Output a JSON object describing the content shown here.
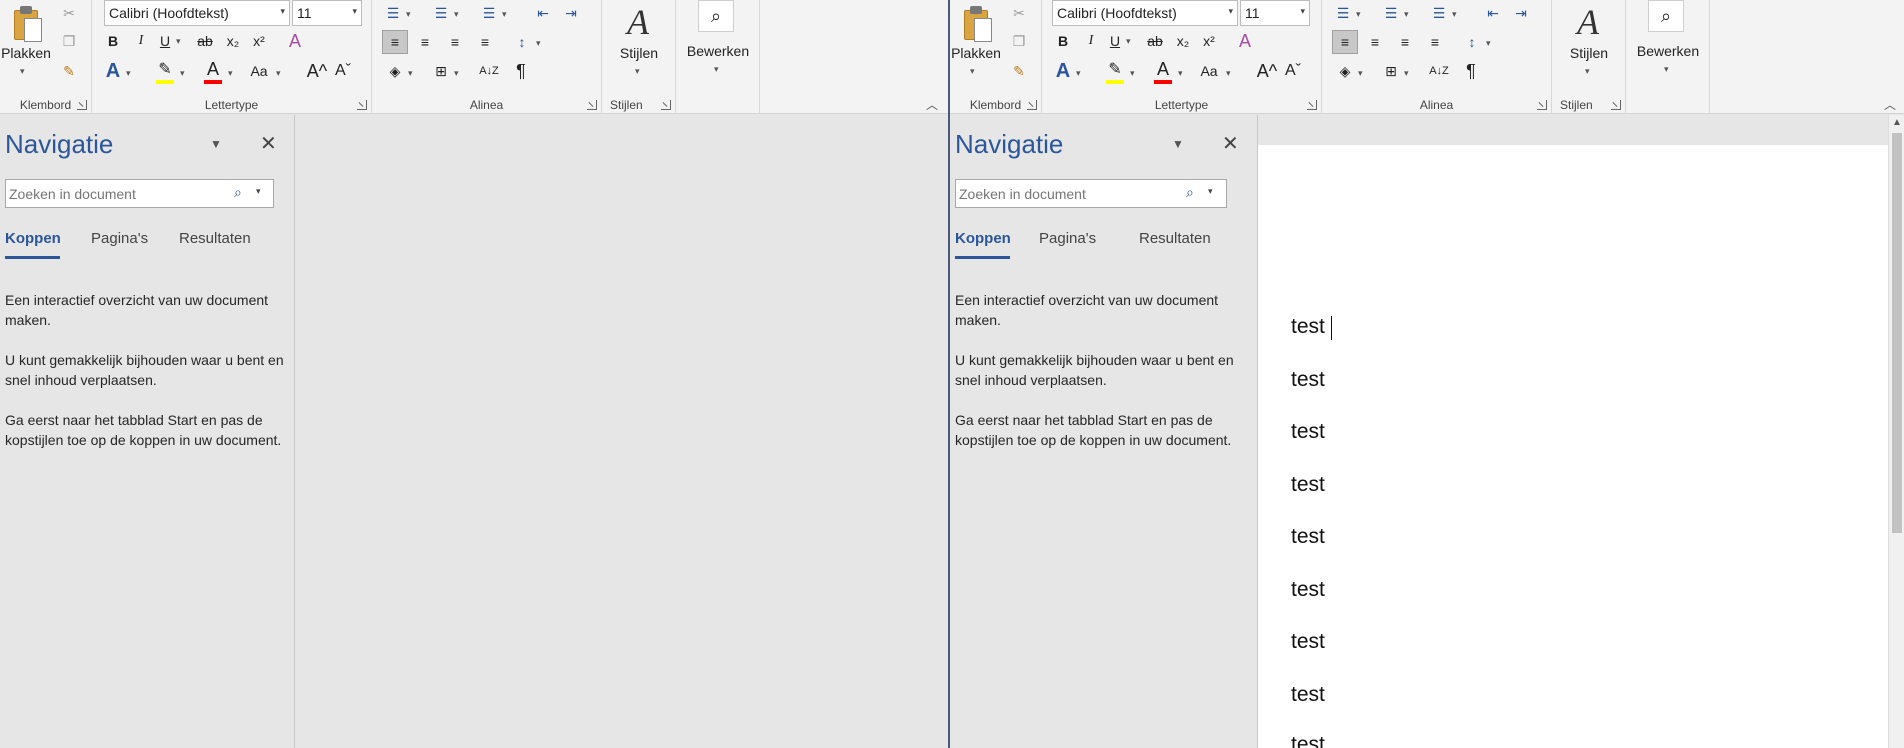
{
  "ribbon": {
    "paste_label": "Plakken",
    "group_clipboard": "Klembord",
    "font_name": "Calibri (Hoofdtekst)",
    "font_size": "11",
    "group_font": "Lettertype",
    "group_paragraph": "Alinea",
    "styles_label": "Stijlen",
    "group_styles": "Stijlen",
    "edit_label": "Bewerken",
    "bold": "B",
    "italic": "I",
    "underline": "U",
    "strike": "ab",
    "subscript": "x₂",
    "superscript": "x²",
    "case": "Aa",
    "grow": "A^",
    "shrink": "Aˇ",
    "font_color": "A",
    "text_effect": "A",
    "pilcrow": "¶",
    "sort": "A↓Z",
    "accent_blue": "#2b579a",
    "highlight_color": "#ffff00",
    "font_color_bar": "#ff0000"
  },
  "nav": {
    "title": "Navigatie",
    "search_placeholder": "Zoeken in document",
    "tabs": [
      "Koppen",
      "Pagina's",
      "Resultaten"
    ],
    "paragraphs": [
      "Een interactief overzicht van uw document maken.",
      "U kunt gemakkelijk bijhouden waar u bent en snel inhoud verplaatsen.",
      "Ga eerst naar het tabblad Start en pas de kopstijlen toe op de koppen in uw document."
    ]
  },
  "document": {
    "lines": [
      "test",
      "test",
      "test",
      "test",
      "test",
      "test",
      "test",
      "test",
      "test"
    ]
  },
  "icons": {
    "close": "close-icon",
    "search": "search-icon",
    "menu": "chevron-down-icon"
  }
}
